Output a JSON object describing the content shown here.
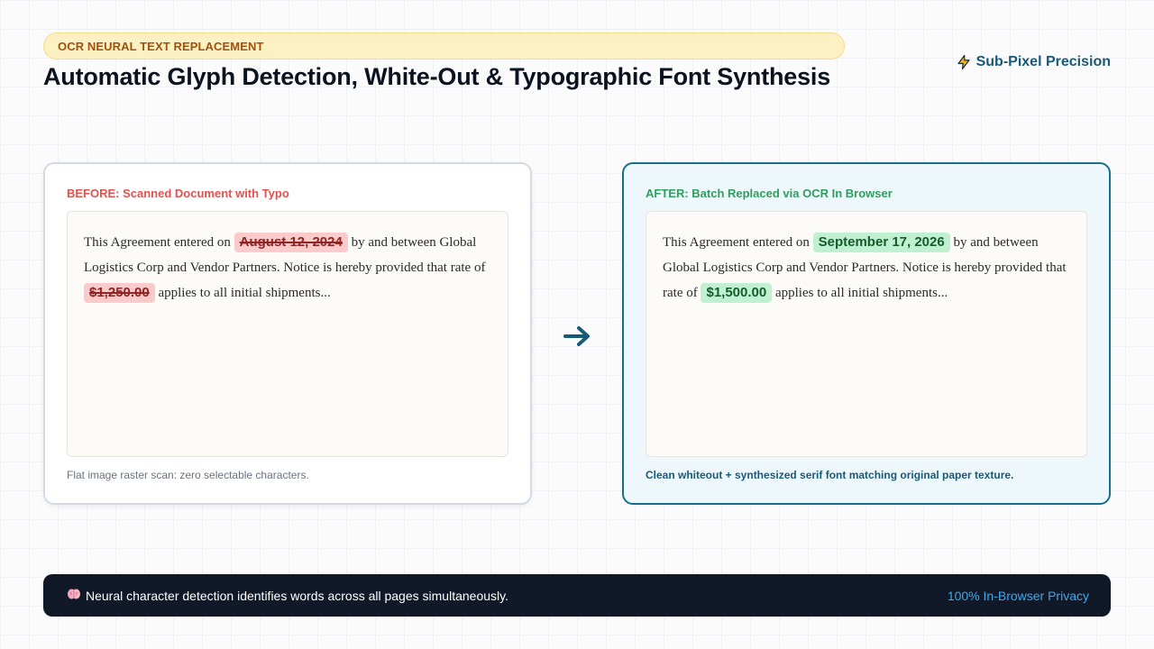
{
  "header": {
    "badge": "OCR NEURAL TEXT REPLACEMENT",
    "title": "Automatic Glyph Detection, White-Out & Typographic Font Synthesis",
    "precision_label": "Sub-Pixel Precision",
    "precision_icon": "lightning-icon"
  },
  "before": {
    "label": "BEFORE: Scanned Document with Typo",
    "text_1": "This Agreement entered on ",
    "date_old": "August 12, 2024",
    "text_2": " by and between Global Logistics Corp and Vendor Partners. Notice is hereby provided that rate of ",
    "amount_old": "$1,250.00",
    "text_3": " applies to all initial shipments...",
    "caption": "Flat image raster scan: zero selectable characters."
  },
  "after": {
    "label": "AFTER: Batch Replaced via OCR In Browser",
    "text_1": "This Agreement entered on ",
    "date_new": "September 17, 2026",
    "text_2": " by and between Global Logistics Corp and Vendor Partners. Notice is hereby provided that rate of ",
    "amount_new": "$1,500.00",
    "text_3": " applies to all initial shipments...",
    "caption": "Clean whiteout + synthesized serif font matching original paper texture."
  },
  "arrow_icon": "arrow-right-icon",
  "footer": {
    "icon": "brain-icon",
    "message": "Neural character detection identifies words across all pages simultaneously.",
    "privacy": "100% In-Browser Privacy"
  },
  "colors": {
    "accent": "#1a6d8c",
    "before_red": "#e0524f",
    "after_green": "#2f9d5e",
    "footer_bg": "#111827",
    "privacy_blue": "#3fa9ee"
  }
}
